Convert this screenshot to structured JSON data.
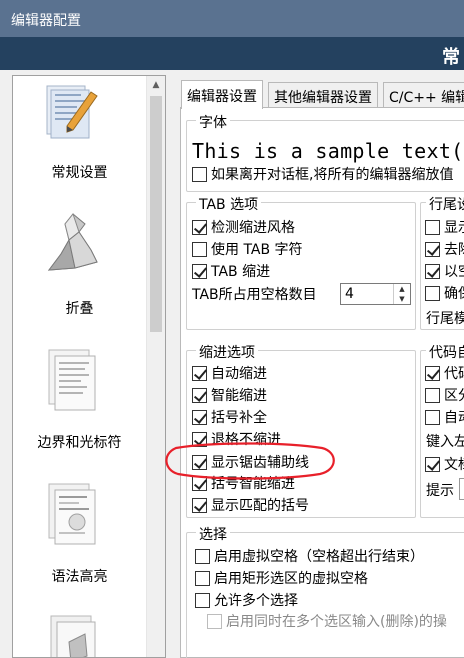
{
  "window": {
    "title": "编辑器配置"
  },
  "header": {
    "title": "常"
  },
  "sidebar": {
    "items": [
      {
        "label": "常规设置",
        "icon": "general-settings-icon"
      },
      {
        "label": "折叠",
        "icon": "folding-icon"
      },
      {
        "label": "边界和光标符",
        "icon": "margins-caret-icon"
      },
      {
        "label": "语法高亮",
        "icon": "syntax-highlight-icon"
      }
    ]
  },
  "tabs": [
    {
      "label": "编辑器设置",
      "active": true
    },
    {
      "label": "其他编辑器设置",
      "active": false
    },
    {
      "label": "C/C++ 编辑",
      "active": false
    }
  ],
  "font_group": {
    "title": "字体",
    "sample": "This is a sample text(E",
    "zoom_option": {
      "label": "如果离开对话框,将所有的编辑器缩放值",
      "checked": false
    }
  },
  "tab_group": {
    "title": "TAB 选项",
    "options": [
      {
        "label": "检测缩进风格",
        "checked": true
      },
      {
        "label": "使用 TAB 字符",
        "checked": false
      },
      {
        "label": "TAB 缩进",
        "checked": true
      }
    ],
    "tab_size_label": "TAB所占用空格数目",
    "tab_size_value": "4"
  },
  "eol_group": {
    "title": "行尾设",
    "options": [
      {
        "label": "显示",
        "checked": false
      },
      {
        "label": "去除",
        "checked": true
      },
      {
        "label": "以空",
        "checked": true
      },
      {
        "label": "确保",
        "checked": false
      }
    ],
    "footer_label": "行尾模"
  },
  "indent_group": {
    "title": "缩进选项",
    "options": [
      {
        "label": "自动缩进",
        "checked": true
      },
      {
        "label": "智能缩进",
        "checked": true
      },
      {
        "label": "括号补全",
        "checked": true
      },
      {
        "label": "退格不缩进",
        "checked": true
      },
      {
        "label": "显示锯齿辅助线",
        "checked": true
      },
      {
        "label": "括号智能缩进",
        "checked": true
      },
      {
        "label": "显示匹配的括号",
        "checked": true
      }
    ]
  },
  "code_group": {
    "title": "代码自",
    "options": [
      {
        "label": "代码",
        "checked": true
      },
      {
        "label": "区分",
        "checked": false
      },
      {
        "label": "自动",
        "checked": false
      }
    ],
    "key_label": "键入左",
    "doc_option": {
      "label": "文档",
      "checked": true
    },
    "hint_label": "提示"
  },
  "selection_group": {
    "title": "选择",
    "options": [
      {
        "label": "启用虚拟空格（空格超出行结束）",
        "checked": false
      },
      {
        "label": "启用矩形选区的虚拟空格",
        "checked": false
      },
      {
        "label": "允许多个选择",
        "checked": false
      },
      {
        "label": "启用同时在多个选区输入(删除)的操",
        "checked": false,
        "disabled": true
      }
    ]
  },
  "colors": {
    "titlebar": "#5a7290",
    "header": "#24415f",
    "highlight_annotation": "#e8202a"
  }
}
